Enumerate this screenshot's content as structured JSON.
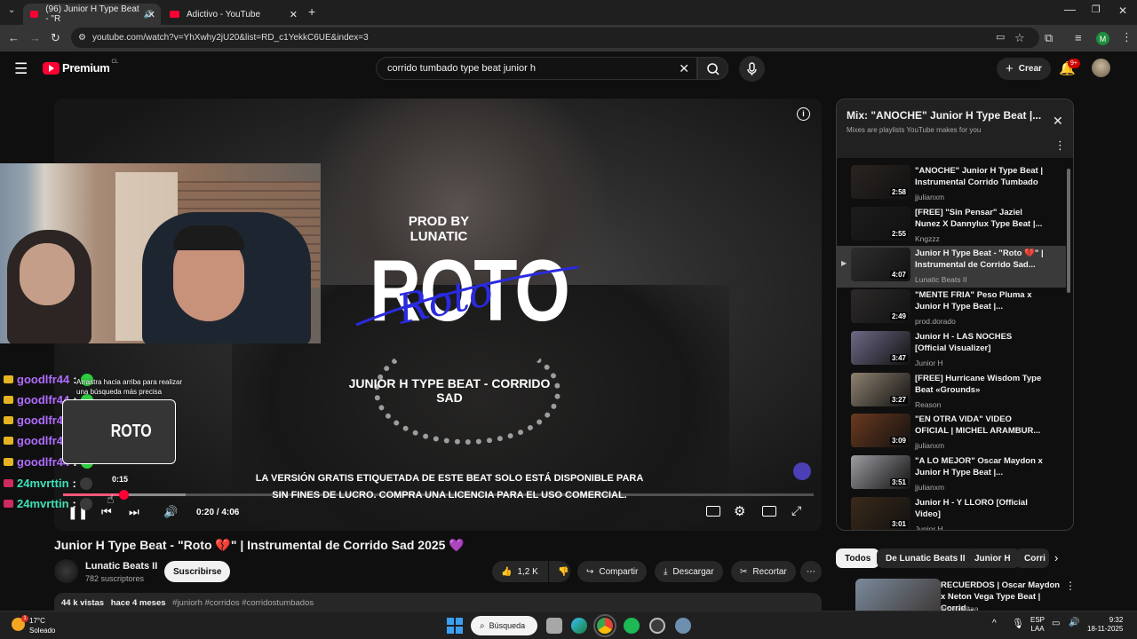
{
  "browser": {
    "tabs": [
      {
        "label": "(96) Junior H Type Beat - \"R"
      },
      {
        "label": "Adictivo - YouTube"
      }
    ],
    "url": "youtube.com/watch?v=YhXwhy2jU20&list=RD_c1YekkC6UE&index=3"
  },
  "header": {
    "logo": "Premium",
    "region": "CL",
    "search_value": "corrido tumbado type beat junior h",
    "create_label": "Crear",
    "notifications": "9+"
  },
  "poster": {
    "prod": "PROD BY LUNATIC",
    "big": "ROTO",
    "script": "Roto",
    "subtitle": "JUNIOR H TYPE BEAT - CORRIDO SAD",
    "notice_line1": "LA VERSIÓN GRATIS ETIQUETADA DE ESTE BEAT SOLO ESTÁ DISPONIBLE PARA",
    "notice_line2": "SIN FINES DE LUCRO. COMPRA UNA LICENCIA PARA EL USO COMERCIAL."
  },
  "overlay": {
    "tooltip_line1": "Arrastra hacia arriba para realizar",
    "tooltip_line2": "una búsqueda más precisa",
    "preview_time": "0:15",
    "chat": [
      {
        "user": "goodlfr44",
        "sep": ":"
      },
      {
        "user": "goodlfr44",
        "sep": ":"
      },
      {
        "user": "goodlfr44",
        "sep": ":"
      },
      {
        "user": "goodlfr44",
        "sep": ":"
      },
      {
        "user": "goodlfr44",
        "sep": ":"
      },
      {
        "user": "24mvrttin",
        "sep": ":"
      },
      {
        "user": "24mvrttin",
        "sep": ":"
      }
    ]
  },
  "player": {
    "time": "0:20 / 4:06",
    "progress": 0.081
  },
  "video": {
    "title": "Junior H Type Beat - \"Roto 💔\" | Instrumental de Corrido Sad 2025 💜",
    "channel": "Lunatic Beats II",
    "subscribers": "782 suscriptores",
    "subscribe_label": "Suscribirse",
    "likes": "1,2 K",
    "share_label": "Compartir",
    "download_label": "Descargar",
    "clip_label": "Recortar",
    "views": "44 k vistas",
    "age": "hace 4 meses",
    "tags": "#juniorh #corridos #corridostumbados"
  },
  "playlist": {
    "title": "Mix: \"ANOCHE\" Junior H Type Beat |...",
    "subtitle": "Mixes are playlists YouTube makes for you",
    "items": [
      {
        "title": "\"ANOCHE\" Junior H Type Beat | Instrumental Corrido Tumbado",
        "channel": "jjulianxm",
        "duration": "2:58",
        "thumb": "#2a2420"
      },
      {
        "title": "[FREE] \"Sin Pensar\" Jaziel Nunez X Dannylux Type Beat |...",
        "channel": "Kngzzz",
        "duration": "2:55",
        "thumb": "#1c1c1c"
      },
      {
        "title": "Junior H Type Beat - \"Roto 💔\" | Instrumental de Corrido Sad...",
        "channel": "Lunatic Beats II",
        "duration": "4:07",
        "thumb": "#2e2e2e"
      },
      {
        "title": "\"MENTE FRIA\" Peso Pluma x Junior H Type Beat |...",
        "channel": "prod.dorado",
        "duration": "2:49",
        "thumb": "#2d2b2a"
      },
      {
        "title": "Junior H - LAS NOCHES [Official Visualizer]",
        "channel": "Junior H",
        "duration": "3:47",
        "thumb": "#6d6a86"
      },
      {
        "title": "[FREE] Hurricane Wisdom Type Beat «Grounds»",
        "channel": "Reason",
        "duration": "3:27",
        "thumb": "#8e8170"
      },
      {
        "title": "\"EN OTRA VIDA\" VIDEO OFICIAL | MICHEL ARAMBUR...",
        "channel": "jjulianxm",
        "duration": "3:09",
        "thumb": "#6b3a1f"
      },
      {
        "title": "\"A LO MEJOR\" Oscar Maydon x Junior H Type Beat |...",
        "channel": "jjulianxm",
        "duration": "3:51",
        "thumb": "#9c9ca2"
      },
      {
        "title": "Junior H - Y LLORO [Official Video]",
        "channel": "Junior H",
        "duration": "3:01",
        "thumb": "#3a2a1a"
      }
    ]
  },
  "chips": [
    "Todos",
    "De Lunatic Beats II",
    "Junior H",
    "Corri"
  ],
  "recommended": {
    "title": "RECUERDOS | Oscar Maydon x Neton Vega Type Beat | Corrid...",
    "channel": "prod.deltaa"
  },
  "taskbar": {
    "temp": "17°C",
    "weather": "Soleado",
    "search_label": "Búsqueda",
    "lang1": "ESP",
    "lang2": "LAA",
    "time": "9:32",
    "date": "18-11-2025"
  }
}
